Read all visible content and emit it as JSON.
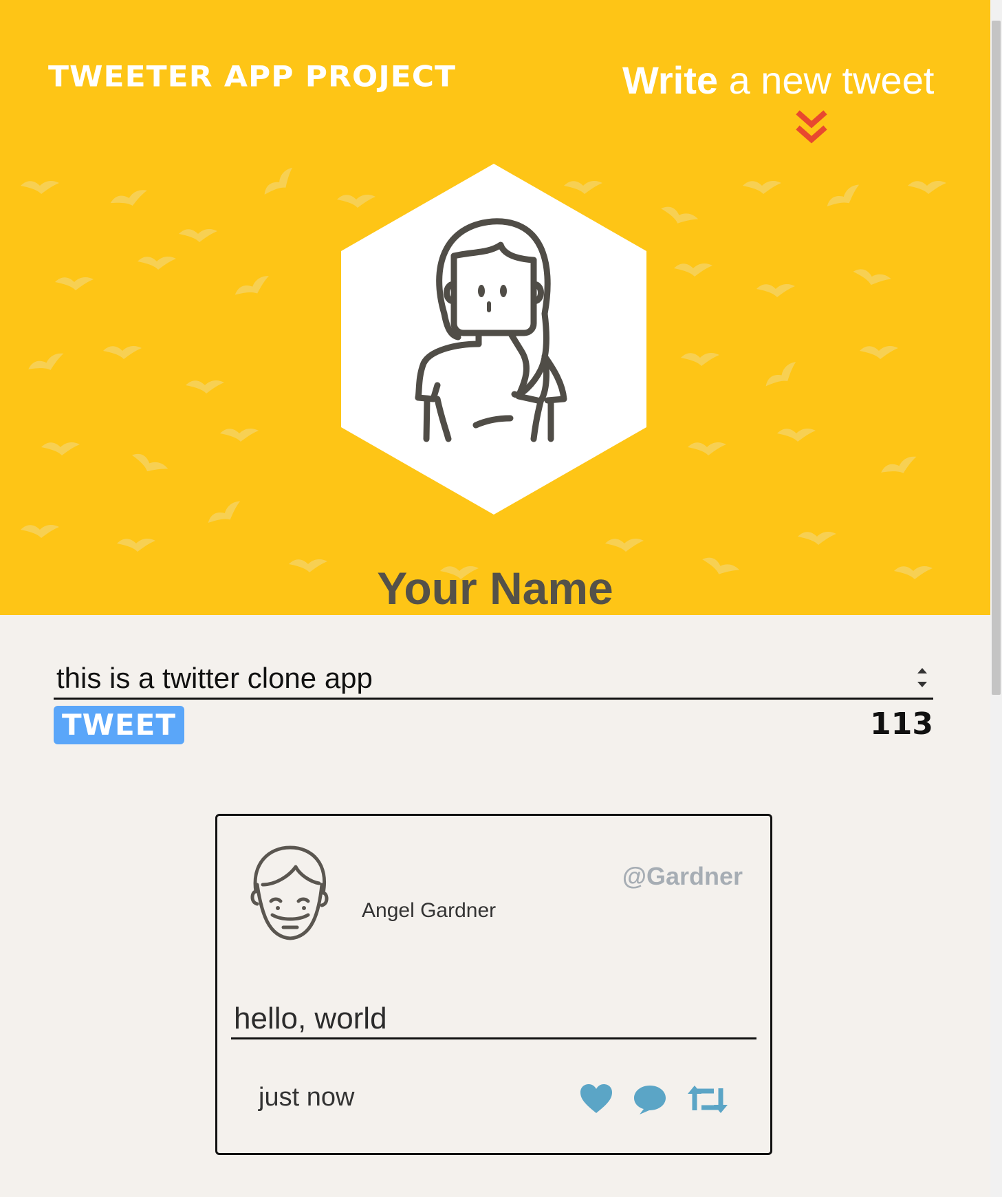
{
  "header": {
    "brand": "TWEETER APP PROJECT",
    "compose_strong": "Write",
    "compose_light": "a new tweet",
    "chevron_icon": "double-chevron-down-icon",
    "accent_color": "#fec516",
    "chevron_color": "#e8492f"
  },
  "profile": {
    "name": "Your Name",
    "avatar_icon": "female-avatar-icon"
  },
  "composer": {
    "value": "this is a twitter clone app",
    "button_label": "TWEET",
    "char_counter": "113",
    "button_color": "#5aa6f9"
  },
  "tweets": [
    {
      "avatar_icon": "smiling-man-avatar-icon",
      "name": "Angel Gardner",
      "handle": "@Gardner",
      "text": "hello, world",
      "timestamp": "just now",
      "actions": [
        "heart-icon",
        "comment-icon",
        "retweet-icon"
      ],
      "action_color": "#5ba5c6"
    }
  ]
}
